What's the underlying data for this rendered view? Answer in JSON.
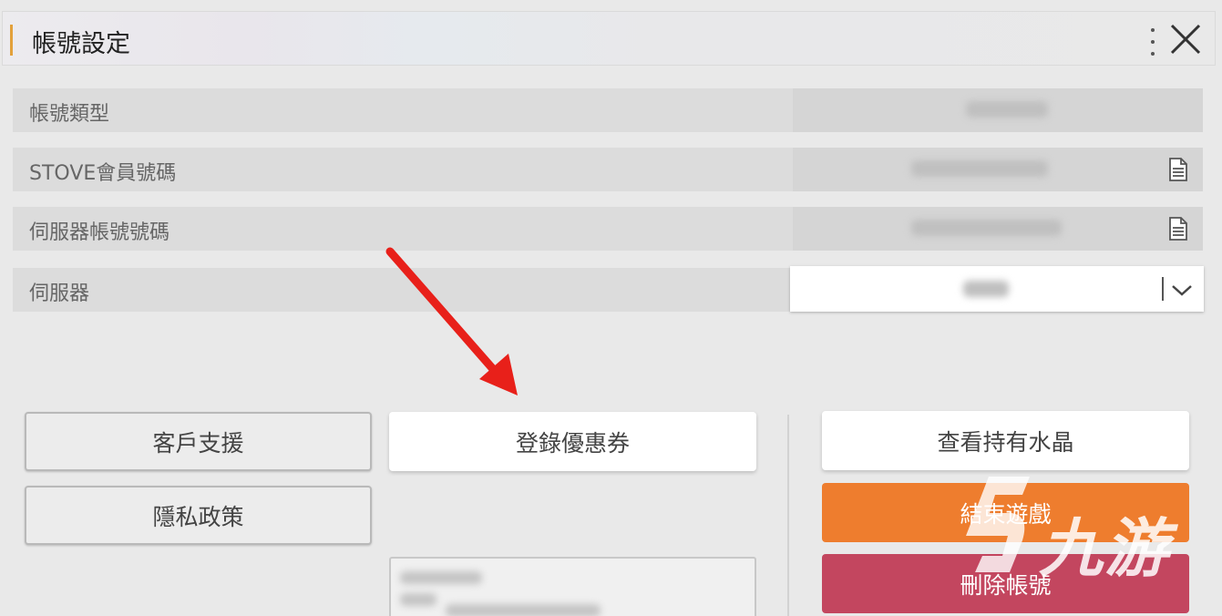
{
  "header": {
    "title": "帳號設定",
    "menu_icon": "kebab-icon",
    "close_icon": "close-icon"
  },
  "rows": [
    {
      "label": "帳號類型",
      "icon": null
    },
    {
      "label": "STOVE會員號碼",
      "icon": "copy-icon"
    },
    {
      "label": "伺服器帳號號碼",
      "icon": "copy-icon"
    },
    {
      "label": "伺服器",
      "icon": "chevron-down-icon"
    }
  ],
  "buttons": {
    "support": "客戶支援",
    "privacy": "隱私政策",
    "coupon": "登錄優惠券",
    "crystals": "查看持有水晶",
    "end_game": "結束遊戲",
    "delete_account": "刪除帳號"
  },
  "watermark": {
    "text": "九游"
  },
  "colors": {
    "accent": "#e3a13b",
    "orange": "#ee7d2e",
    "red": "#c3465f",
    "arrow": "#e8201a"
  }
}
